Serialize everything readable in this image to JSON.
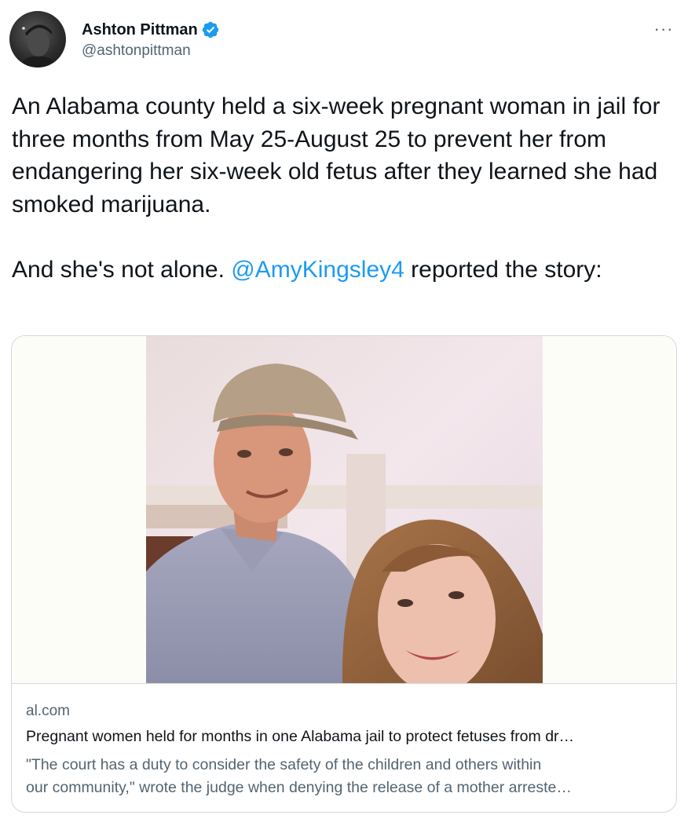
{
  "author": {
    "name": "Ashton Pittman",
    "handle": "@ashtonpittman",
    "verified": true
  },
  "tweet": {
    "text_part1": "An Alabama county held a six-week pregnant woman in jail for three months from May 25-August 25 to prevent her from endangering her six-week old fetus after they learned she had smoked marijuana.\n\nAnd she's not alone. ",
    "mention": "@AmyKingsley4",
    "text_part2": " reported the story:"
  },
  "card": {
    "domain": "al.com",
    "title": "Pregnant women held for months in one Alabama jail to protect fetuses from dr…",
    "description_line1": "\"The court has a duty to consider the safety of the children and others within",
    "description_line2": "our community,\" wrote the judge when denying the release of a mother arreste…"
  },
  "icons": {
    "more": "more-options-icon",
    "verified": "verified-badge-icon"
  },
  "colors": {
    "accent": "#1d9bf0",
    "secondary_text": "#536471",
    "border": "#cfd9de"
  }
}
